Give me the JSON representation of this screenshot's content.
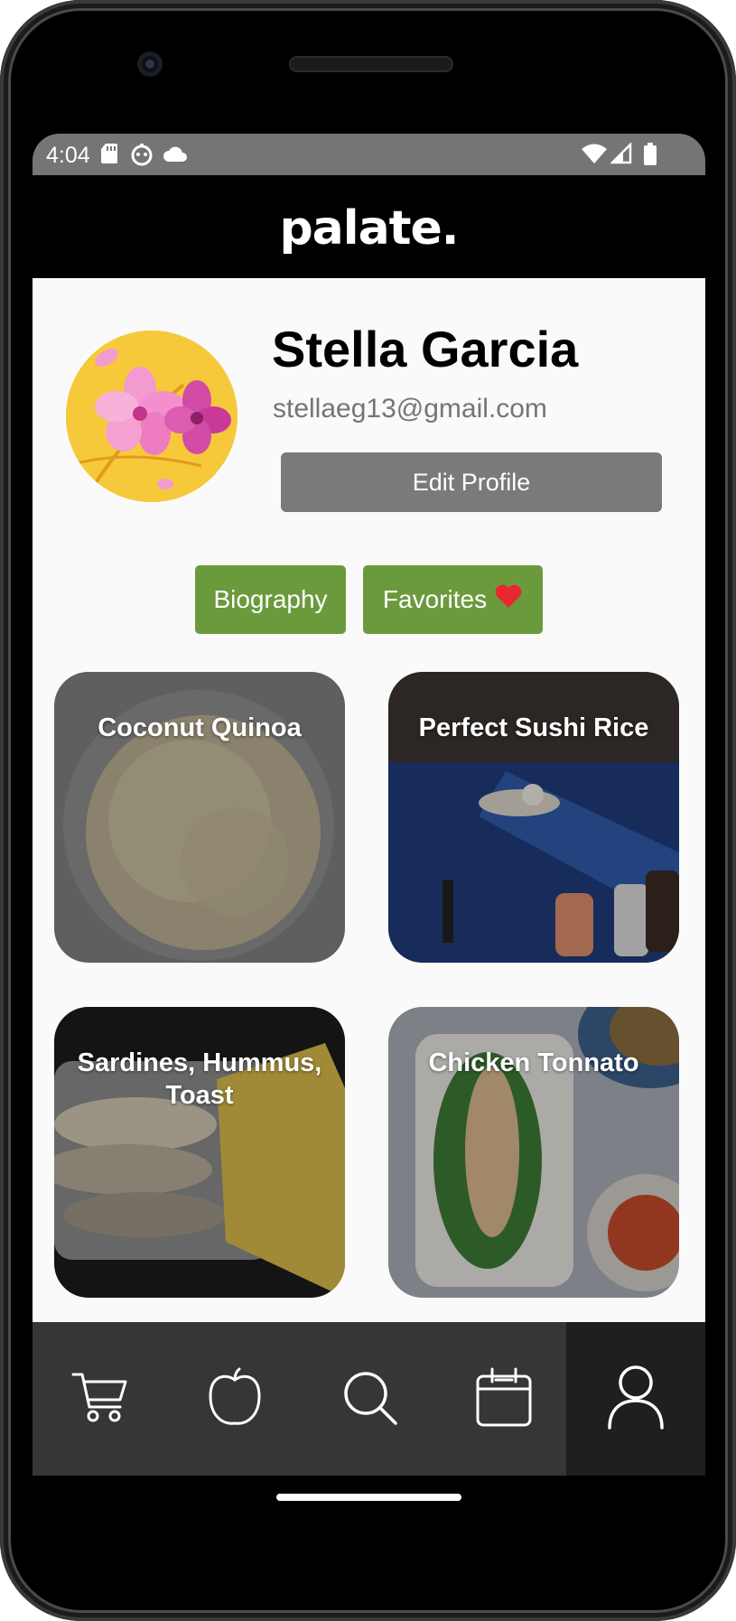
{
  "status_bar": {
    "time": "4:04",
    "left_icons": [
      "sd-card-icon",
      "robot-face-icon",
      "cloud-icon"
    ],
    "right_icons": [
      "wifi-icon",
      "cellular-signal-icon",
      "battery-icon"
    ]
  },
  "app": {
    "logo": "palate."
  },
  "profile": {
    "name": "Stella Garcia",
    "email": "stellaeg13@gmail.com",
    "edit_label": "Edit Profile",
    "avatar": "flower-avatar"
  },
  "tabs": {
    "biography": "Biography",
    "favorites": "Favorites",
    "favorites_icon": "heart-icon"
  },
  "recipes": [
    {
      "title": "Coconut Quinoa"
    },
    {
      "title": "Perfect Sushi Rice"
    },
    {
      "title": "Sardines, Hummus, Toast"
    },
    {
      "title": "Chicken Tonnato"
    }
  ],
  "nav": {
    "items": [
      "cart-icon",
      "apple-icon",
      "search-icon",
      "calendar-icon",
      "profile-icon"
    ],
    "active": "profile-icon"
  },
  "colors": {
    "accent_green": "#6b9a3c",
    "edit_button": "#7a7a7a",
    "nav_bg": "#363636",
    "nav_active": "#1f1f1f",
    "heart": "#e8272f"
  }
}
